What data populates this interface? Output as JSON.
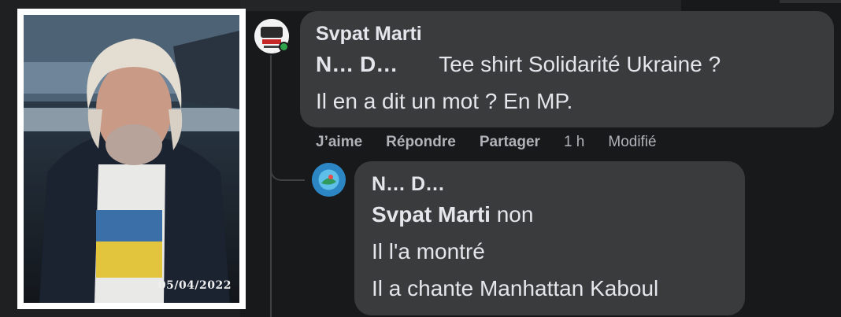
{
  "photo": {
    "date_stamp": "05/04/2022"
  },
  "comment1": {
    "author": "Svpat Marti",
    "mention": "N… D…",
    "line1_text": "Tee shirt Solidarité Ukraine ?",
    "line2_text": "Il en a dit un mot ? En MP."
  },
  "actions": {
    "like": "J’aime",
    "reply": "Répondre",
    "share": "Partager",
    "time": "1 h",
    "edited": "Modifié"
  },
  "reply1": {
    "author": "N… D…",
    "mention": "Svpat Marti",
    "line1_text": "non",
    "line2_text": "Il l'a montré",
    "line3_text": "Il a chante Manhattan Kaboul"
  },
  "colors": {
    "background": "#18191a",
    "bubble": "#3a3b3c",
    "text": "#e4e6eb",
    "secondary_text": "#b0b3b8",
    "online": "#31a24c"
  }
}
